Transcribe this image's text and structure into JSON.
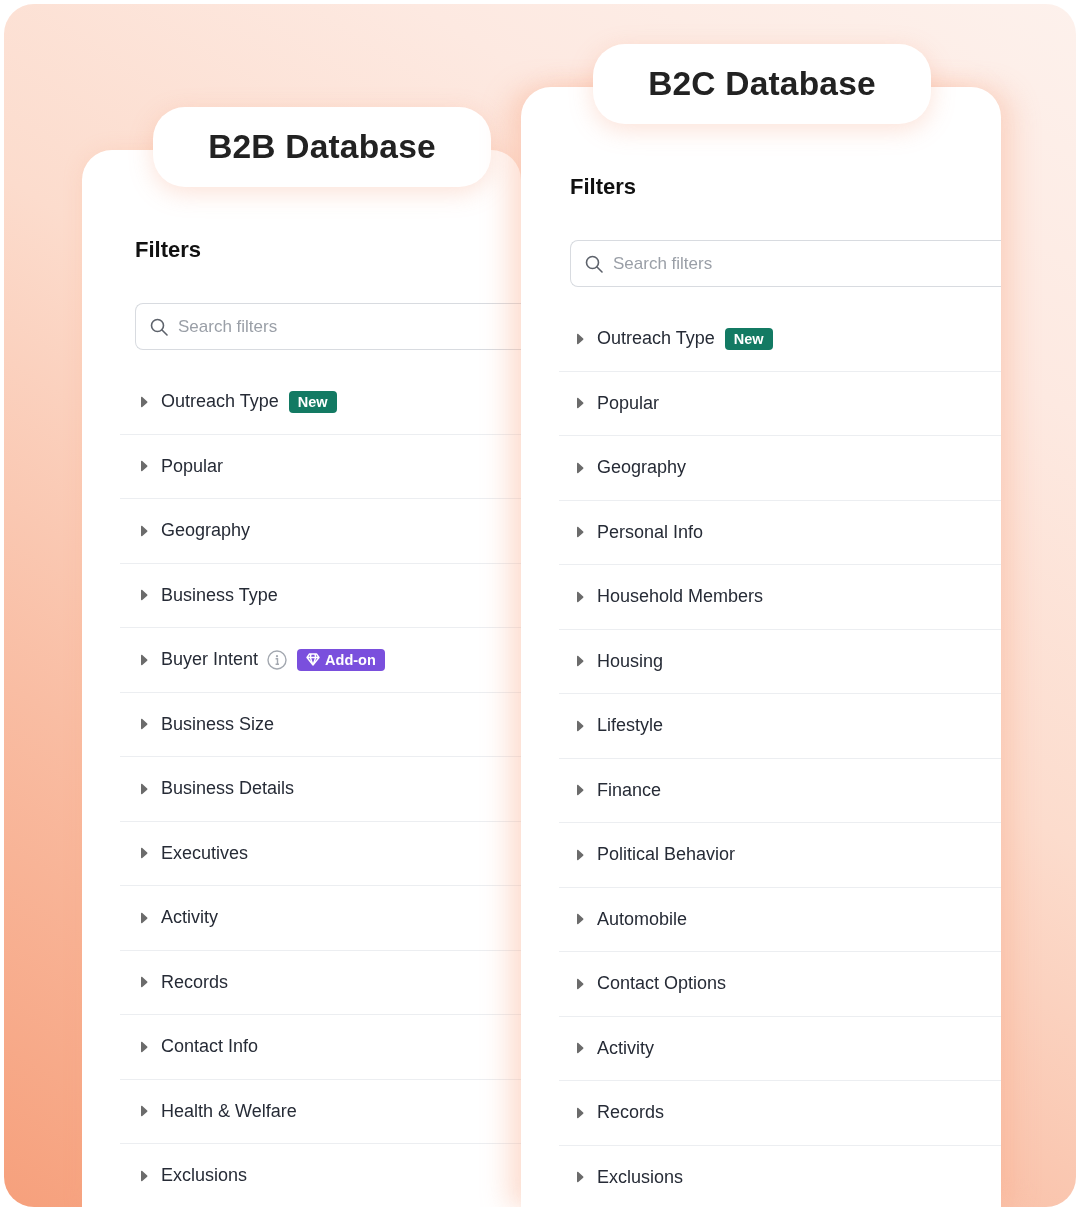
{
  "panels": [
    {
      "title": "B2B Database",
      "heading": "Filters",
      "search": {
        "placeholder": "Search filters"
      },
      "items": [
        {
          "label": "Outreach Type",
          "expanded": false,
          "badge": {
            "kind": "new",
            "text": "New"
          }
        },
        {
          "label": "Popular",
          "expanded": false
        },
        {
          "label": "Geography",
          "expanded": false
        },
        {
          "label": "Business Type",
          "expanded": false
        },
        {
          "label": "Buyer Intent",
          "expanded": false,
          "info": true,
          "badge": {
            "kind": "addon",
            "text": "Add-on"
          }
        },
        {
          "label": "Business Size",
          "expanded": false
        },
        {
          "label": "Business Details",
          "expanded": false
        },
        {
          "label": "Executives",
          "expanded": false
        },
        {
          "label": "Activity",
          "expanded": false
        },
        {
          "label": "Records",
          "expanded": false
        },
        {
          "label": "Contact Info",
          "expanded": false
        },
        {
          "label": "Health & Welfare",
          "expanded": false
        },
        {
          "label": "Exclusions",
          "expanded": false
        }
      ]
    },
    {
      "title": "B2C Database",
      "heading": "Filters",
      "search": {
        "placeholder": "Search filters"
      },
      "items": [
        {
          "label": "Outreach Type",
          "expanded": false,
          "badge": {
            "kind": "new",
            "text": "New"
          }
        },
        {
          "label": "Popular",
          "expanded": false
        },
        {
          "label": "Geography",
          "expanded": false
        },
        {
          "label": "Personal Info",
          "expanded": false
        },
        {
          "label": "Household Members",
          "expanded": false
        },
        {
          "label": "Housing",
          "expanded": false
        },
        {
          "label": "Lifestyle",
          "expanded": false
        },
        {
          "label": "Finance",
          "expanded": false
        },
        {
          "label": "Political Behavior",
          "expanded": false
        },
        {
          "label": "Automobile",
          "expanded": false
        },
        {
          "label": "Contact Options",
          "expanded": false
        },
        {
          "label": "Activity",
          "expanded": false
        },
        {
          "label": "Records",
          "expanded": false
        },
        {
          "label": "Exclusions",
          "expanded": false
        }
      ]
    }
  ]
}
